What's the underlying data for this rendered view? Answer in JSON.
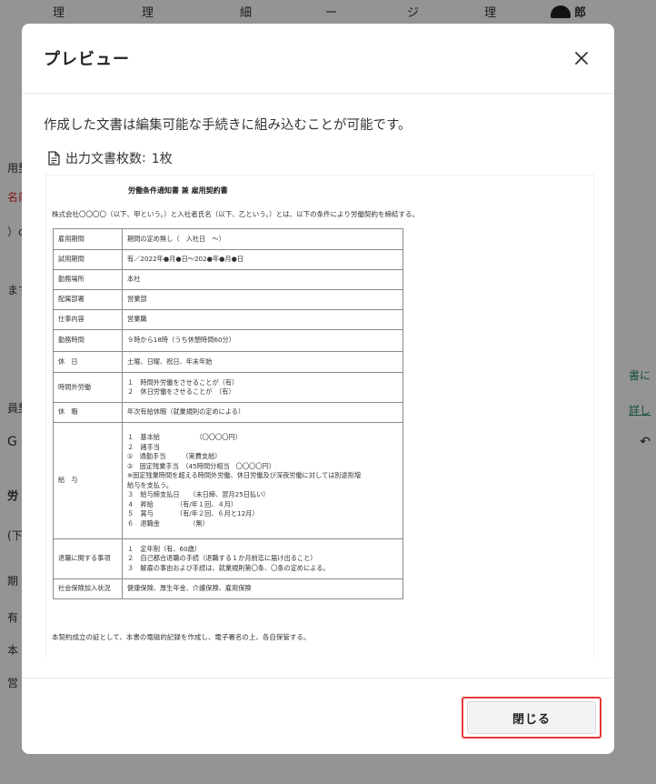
{
  "background": {
    "header_chars": [
      "理",
      "理",
      "細",
      "ー",
      "ジ",
      "理",
      "郎"
    ],
    "left_fragments": [
      "用契",
      "名前",
      "）c",
      "ます",
      "員契",
      "G",
      "労",
      "(下",
      "期",
      "有",
      "本",
      "営"
    ],
    "right_fragments": [
      "書に",
      "詳し",
      "↶"
    ]
  },
  "modal": {
    "title": "プレビュー",
    "description": "作成した文書は編集可能な手続きに組み込むことが可能です。",
    "doc_count_label": "出力文書枚数",
    "doc_count_value": "1枚",
    "close_label": "閉じる"
  },
  "document": {
    "title": "労働条件通知書 兼 雇用契約書",
    "intro": "株式会社〇〇〇〇（以下、甲という。）と入社者氏名（以下、乙という。）とは、以下の条件により労働契約を締結する。",
    "rows": [
      {
        "label": "雇用期間",
        "lines": [
          "期間の定め無し（　入社日　～）"
        ]
      },
      {
        "label": "試用期間",
        "lines": [
          "有／2022年●月●日～202●年●月●日"
        ]
      },
      {
        "label": "勤務場所",
        "lines": [
          "本社"
        ]
      },
      {
        "label": "配属部署",
        "lines": [
          "営業部"
        ]
      },
      {
        "label": "仕事内容",
        "lines": [
          "営業職"
        ]
      },
      {
        "label": "勤務時間",
        "lines": [
          "９時から18時（うち休憩時間60分）"
        ]
      },
      {
        "label": "休　日",
        "lines": [
          "土曜、日曜、祝日、年末年始"
        ]
      },
      {
        "label": "時間外労働",
        "lines": [
          "１　時間外労働をさせることが（有）",
          "２　休日労働をさせることが　（有）"
        ]
      },
      {
        "label": "休　暇",
        "lines": [
          "年次有給休暇（就業規則の定めによる）"
        ]
      },
      {
        "label": "給　与",
        "lines": [
          "１　基本給　　　　　　（〇〇〇〇円）",
          "２　諸手当",
          "①　通勤手当　　　（実費支給）",
          "②　固定残業手当　（45時間分相当　〇〇〇〇円）",
          "※固定残業時間を超える時間外労働、休日労働及び深夜労働に対しては別途割増",
          "給与を支払う。",
          "３　給与締支払日　　（末日締、翌月25日払い）",
          "４　昇給　　　　（有/年１回、４月）",
          "５　賞与　　　　（有/年２回、６月と12月）",
          "６　退職金　　　　　（無）"
        ]
      },
      {
        "label": "退職に関する事項",
        "lines": [
          "１　定年制（有、60歳）",
          "２　自己都合退職の手続（退職する１か月前迄に届け出ること）",
          "３　解雇の事由および手続は、就業規則第〇条、〇条の定めによる。"
        ]
      },
      {
        "label": "社会保険加入状況",
        "lines": [
          "健康保険、厚生年金、介護保険、雇用保険"
        ]
      }
    ],
    "footer": "本契約成立の証として、本書の電磁的記録を作成し、電子署名の上、各自保管する。"
  }
}
